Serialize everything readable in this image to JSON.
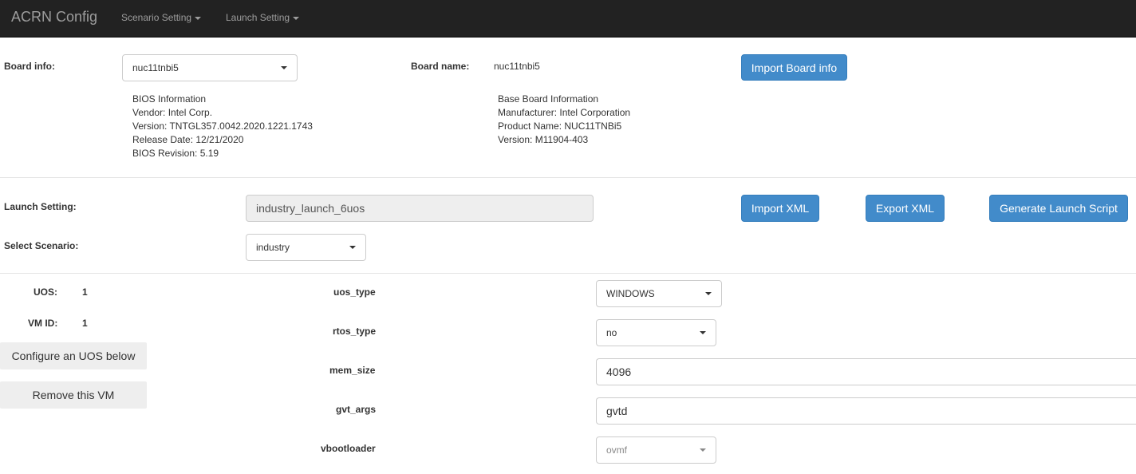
{
  "navbar": {
    "brand": "ACRN Config",
    "items": [
      "Scenario Setting",
      "Launch Setting"
    ]
  },
  "board": {
    "info_label": "Board info:",
    "selected": "nuc11tnbi5",
    "name_label": "Board name:",
    "name_value": "nuc11tnbi5",
    "import_button": "Import Board info",
    "bios": [
      "BIOS Information",
      "Vendor: Intel Corp.",
      "Version: TNTGL357.0042.2020.1221.1743",
      "Release Date: 12/21/2020",
      "BIOS Revision: 5.19"
    ],
    "baseboard": [
      "Base Board Information",
      "Manufacturer: Intel Corporation",
      "Product Name: NUC11TNBi5",
      "Version: M11904-403"
    ]
  },
  "launch": {
    "setting_label": "Launch Setting:",
    "setting_value": "industry_launch_6uos",
    "scenario_label": "Select Scenario:",
    "scenario_value": "industry",
    "import_xml": "Import XML",
    "export_xml": "Export XML",
    "generate": "Generate Launch Script"
  },
  "vm": {
    "uos_label": "UOS:",
    "uos_value": "1",
    "vmid_label": "VM ID:",
    "vmid_value": "1",
    "configure_button": "Configure an UOS below",
    "remove_button": "Remove this VM",
    "fields": {
      "uos_type": {
        "label": "uos_type",
        "value": "WINDOWS"
      },
      "rtos_type": {
        "label": "rtos_type",
        "value": "no"
      },
      "mem_size": {
        "label": "mem_size",
        "value": "4096"
      },
      "gvt_args": {
        "label": "gvt_args",
        "value": "gvtd"
      },
      "vbootloader": {
        "label": "vbootloader",
        "value": "ovmf"
      }
    }
  }
}
